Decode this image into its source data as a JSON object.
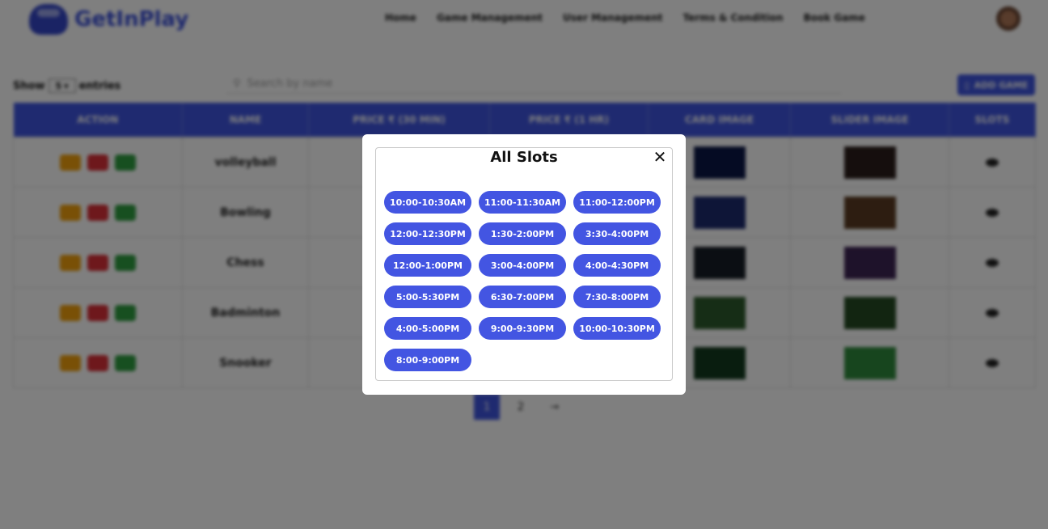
{
  "navbar": {
    "brand": "GetInPlay",
    "links": [
      "Home",
      "Game Management",
      "User Management",
      "Terms & Condition",
      "Book Game"
    ]
  },
  "toolbar": {
    "show_label": "Show",
    "entries_value": "5",
    "entries_label": "entries",
    "search_placeholder": "Search by name",
    "add_label": "ADD GAME"
  },
  "table": {
    "headers": [
      "ACTION",
      "NAME",
      "PRICE ₹ (30 MIN)",
      "PRICE ₹ (1 HR)",
      "CARD IMAGE",
      "SLIDER IMAGE",
      "SLOTS"
    ],
    "rows": [
      {
        "name": "volleyball",
        "card_color": "#0b1746",
        "slider_color": "#2a1d1a"
      },
      {
        "name": "Bowling",
        "card_color": "#1c2a6e",
        "slider_color": "#5a3b22"
      },
      {
        "name": "Chess",
        "card_color": "#171d26",
        "slider_color": "#3d2454"
      },
      {
        "name": "Badminton",
        "card_color": "#2d5a2c",
        "slider_color": "#244a22"
      },
      {
        "name": "Snooker",
        "card_color": "#123a1e",
        "slider_color": "#2f8a3c"
      }
    ]
  },
  "pagination": {
    "pages": [
      "1",
      "2"
    ],
    "next": "→"
  },
  "modal": {
    "title": "All Slots",
    "close_symbol": "✕",
    "slots": [
      "10:00-10:30AM",
      "11:00-11:30AM",
      "11:00-12:00PM",
      "12:00-12:30PM",
      "1:30-2:00PM",
      "3:30-4:00PM",
      "12:00-1:00PM",
      "3:00-4:00PM",
      "4:00-4:30PM",
      "5:00-5:30PM",
      "6:30-7:00PM",
      "7:30-8:00PM",
      "4:00-5:00PM",
      "9:00-9:30PM",
      "10:00-10:30PM",
      "8:00-9:00PM"
    ]
  }
}
